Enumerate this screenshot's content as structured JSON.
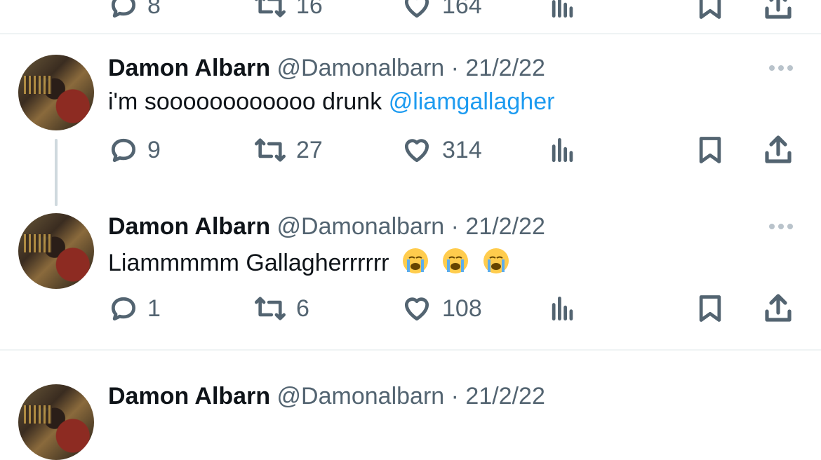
{
  "top_tweet_actions": {
    "reply": "8",
    "retweet": "16",
    "like": "164"
  },
  "tweets": [
    {
      "name": "Damon Albarn",
      "handle": "@Damonalbarn",
      "separator": "·",
      "date": "21/2/22",
      "text_plain": "i'm soooooooooooo drunk",
      "mention": "@liamgallagher",
      "replies": "9",
      "retweets": "27",
      "likes": "314"
    },
    {
      "name": "Damon Albarn",
      "handle": "@Damonalbarn",
      "separator": "·",
      "date": "21/2/22",
      "text_plain": "Liammmmm Gallagherrrrrr",
      "emojis": [
        "loudly-crying-face",
        "loudly-crying-face",
        "loudly-crying-face"
      ],
      "replies": "1",
      "retweets": "6",
      "likes": "108"
    },
    {
      "name": "Damon Albarn",
      "handle": "@Damonalbarn",
      "separator": "·",
      "date": "21/2/22"
    }
  ],
  "colors": {
    "accent": "#1d9bf0",
    "muted": "#536471",
    "divider": "#eff3f4"
  },
  "icons": [
    "reply-icon",
    "retweet-icon",
    "like-icon",
    "views-icon",
    "bookmark-icon",
    "share-icon",
    "more-icon"
  ]
}
